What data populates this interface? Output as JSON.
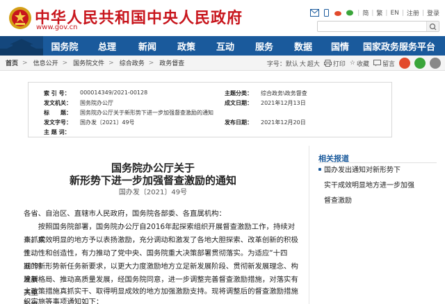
{
  "site": {
    "title": "中华人民共和国中央人民政府",
    "url": "www.gov.cn"
  },
  "top_links": [
    "简",
    "繁",
    "EN",
    "注册",
    "登录"
  ],
  "search": {
    "placeholder": ""
  },
  "nav": {
    "items": [
      "国务院",
      "总理",
      "新闻",
      "政策",
      "互动",
      "服务",
      "数据",
      "国情",
      "国家政务服务平台"
    ]
  },
  "breadcrumb": {
    "items": [
      "首页",
      "信息公开",
      "国务院文件",
      "综合政务",
      "政务督查"
    ],
    "sep": ">",
    "tools": [
      "字号：默认",
      "大",
      "超大",
      "打印",
      "收藏",
      "留言"
    ]
  },
  "info": {
    "index_label": "索 引 号：",
    "index_value": "000014349/2021-00128",
    "category_label": "主题分类：",
    "category_value": "综合政务\\政务督查",
    "issuer_label": "发文机关：",
    "issuer_value": "国务院办公厅",
    "created_label": "成文日期：",
    "created_value": "2021年12月13日",
    "title_label": "标　　题：",
    "title_value": "国务院办公厅关于新形势下进一步加强督查激励的通知",
    "docno_label": "发文字号：",
    "docno_value": "国办发〔2021〕49号",
    "published_label": "发布日期：",
    "published_value": "2021年12月20日",
    "keywords_label": "主 题 词："
  },
  "article": {
    "title_line1": "国务院办公厅关于",
    "title_line2": "新形势下进一步加强督查激励的通知",
    "docno": "国办发〔2021〕49号",
    "paragraphs": [
      "各省、自治区、直辖市人民政府，国务院各部委、各直属机构：",
      "　　按照国务院部署，国务院办公厅自2016年起探索组织开展督查激励工作，持续对真抓实",
      "干、成效明显的地方予以表扬激励，充分调动和激发了各地大胆探索、改革创新的积极性、",
      "主动性和创造性，有力推动了党中央、国务院重大决策部署贯彻落实。为适应“十四五”时",
      "期的新形势新任务新要求，以更大力度激励地方立足新发展阶段、贯彻新发展理念、构建新",
      "发展格局、推动高质量发展，经国务院同意，进一步调整完善督查激励措施，对落实有关重",
      "大政策措施真抓实干、取得明显成效的地方加强激励支持。现将调整后的督查激励措施及组",
      "织实施等事项通知如下："
    ]
  },
  "related": {
    "title": "相关报道",
    "item_lines": [
      "国办发出通知对新形势下",
      "实干成效明显地方进一步加强",
      "督查激励"
    ]
  }
}
